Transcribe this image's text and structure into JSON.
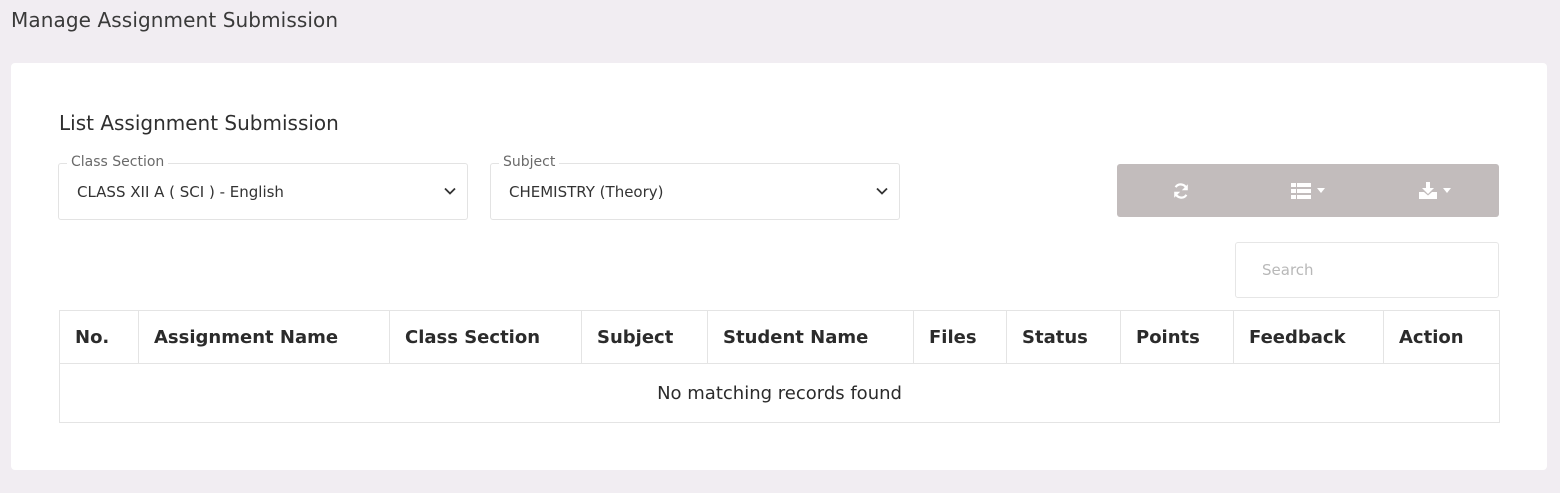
{
  "page": {
    "title": "Manage Assignment Submission"
  },
  "card": {
    "title": "List Assignment Submission"
  },
  "filters": {
    "class_section": {
      "label": "Class Section",
      "value": "CLASS XII A ( SCI ) - English"
    },
    "subject": {
      "label": "Subject",
      "value": "CHEMISTRY (Theory)"
    }
  },
  "toolbar": {
    "color": "#c2bcbc",
    "buttons": [
      {
        "icon": "refresh-icon"
      },
      {
        "icon": "columns-list-icon",
        "dropdown": true
      },
      {
        "icon": "download-icon",
        "dropdown": true
      }
    ]
  },
  "search": {
    "placeholder": "Search",
    "value": ""
  },
  "table": {
    "columns": [
      "No.",
      "Assignment Name",
      "Class Section",
      "Subject",
      "Student Name",
      "Files",
      "Status",
      "Points",
      "Feedback",
      "Action"
    ],
    "empty_message": "No matching records found"
  }
}
